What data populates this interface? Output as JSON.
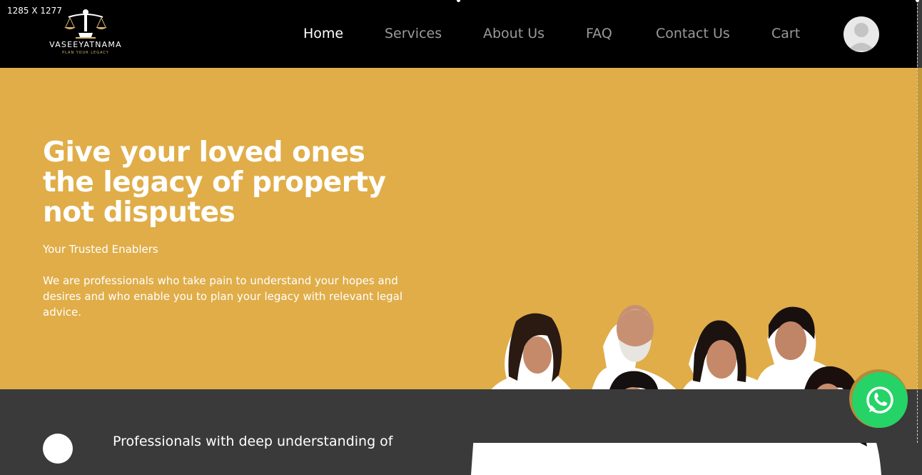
{
  "overlay": {
    "dimensions_label": "1285 X 1277"
  },
  "brand": {
    "name": "VASEEYATNAMA",
    "tagline": "PLAN YOUR LEGACY"
  },
  "nav": {
    "items": [
      {
        "label": "Home",
        "active": true
      },
      {
        "label": "Services",
        "active": false
      },
      {
        "label": "About Us",
        "active": false
      },
      {
        "label": "FAQ",
        "active": false
      },
      {
        "label": "Contact Us",
        "active": false
      },
      {
        "label": "Cart",
        "active": false
      }
    ]
  },
  "hero": {
    "title": "Give your loved ones the legacy of property not disputes",
    "subtitle": "Your Trusted Enablers",
    "description": "We are professionals who take pain to understand your hopes and desires and who enable you to plan your legacy with relevant legal advice."
  },
  "features": {
    "first": "Professionals with deep understanding of"
  },
  "icons": {
    "logo": "scales-of-justice-icon",
    "avatar": "user-avatar-icon",
    "whatsapp": "whatsapp-icon"
  },
  "colors": {
    "header_bg": "#000000",
    "hero_bg": "#e0ad48",
    "dark_section_bg": "#3a3a3a",
    "whatsapp": "#25d366",
    "nav_inactive": "#9a9a9a",
    "nav_active": "#ffffff"
  }
}
